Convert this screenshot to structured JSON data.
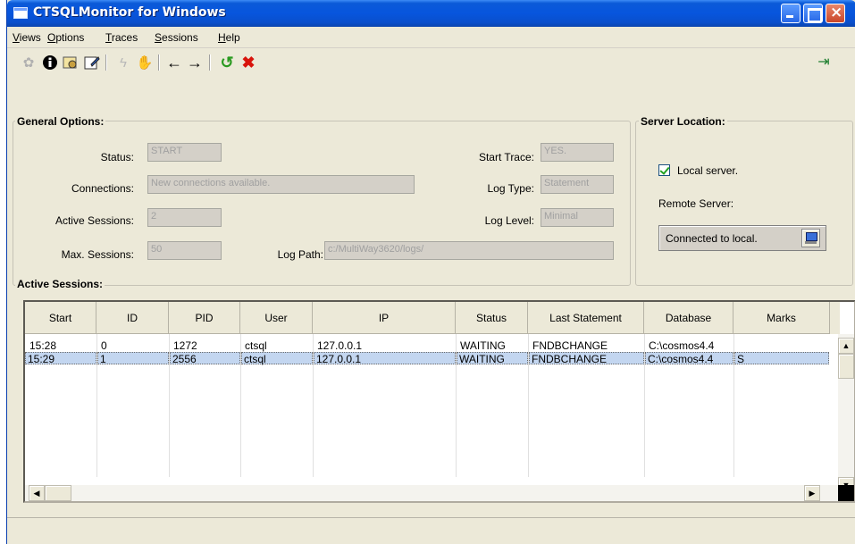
{
  "window": {
    "title": "CTSQLMonitor for Windows"
  },
  "menu": [
    {
      "label": "Views",
      "acc": "V",
      "rest": "iews"
    },
    {
      "label": "Options",
      "acc": "O",
      "rest": "ptions"
    },
    {
      "label": "Traces",
      "acc": "T",
      "rest": "races"
    },
    {
      "label": "Sessions",
      "acc": "S",
      "rest": "essions"
    },
    {
      "label": "Help",
      "acc": "H",
      "rest": "elp"
    }
  ],
  "general": {
    "title": "General Options:",
    "status_label": "Status:",
    "status_value": "START",
    "connections_label": "Connections:",
    "connections_value": "New connections available.",
    "active_sessions_label": "Active Sessions:",
    "active_sessions_value": "2",
    "max_sessions_label": "Max. Sessions:",
    "max_sessions_value": "50",
    "start_trace_label": "Start Trace:",
    "start_trace_value": "YES.",
    "log_type_label": "Log Type:",
    "log_type_value": "Statement",
    "log_level_label": "Log Level:",
    "log_level_value": "Minimal",
    "log_path_label": "Log Path:",
    "log_path_value": "c:/MultiWay3620/logs/"
  },
  "server": {
    "title": "Server Location:",
    "local_label": "Local server.",
    "local_checked": true,
    "remote_label": "Remote Server:",
    "connected_text": "Connected to local."
  },
  "sessions": {
    "title": "Active Sessions:",
    "columns": [
      "Start",
      "ID",
      "PID",
      "User",
      "IP",
      "Status",
      "Last Statement",
      "Database",
      "Marks"
    ],
    "rows": [
      [
        "15:28",
        "0",
        "1272",
        "ctsql",
        "127.0.0.1",
        "WAITING",
        "FNDBCHANGE",
        "C:\\cosmos4.4",
        ""
      ],
      [
        "15:29",
        "1",
        "2556",
        "ctsql",
        "127.0.0.1",
        "WAITING",
        "FNDBCHANGE",
        "C:\\cosmos4.4",
        "S"
      ]
    ]
  }
}
